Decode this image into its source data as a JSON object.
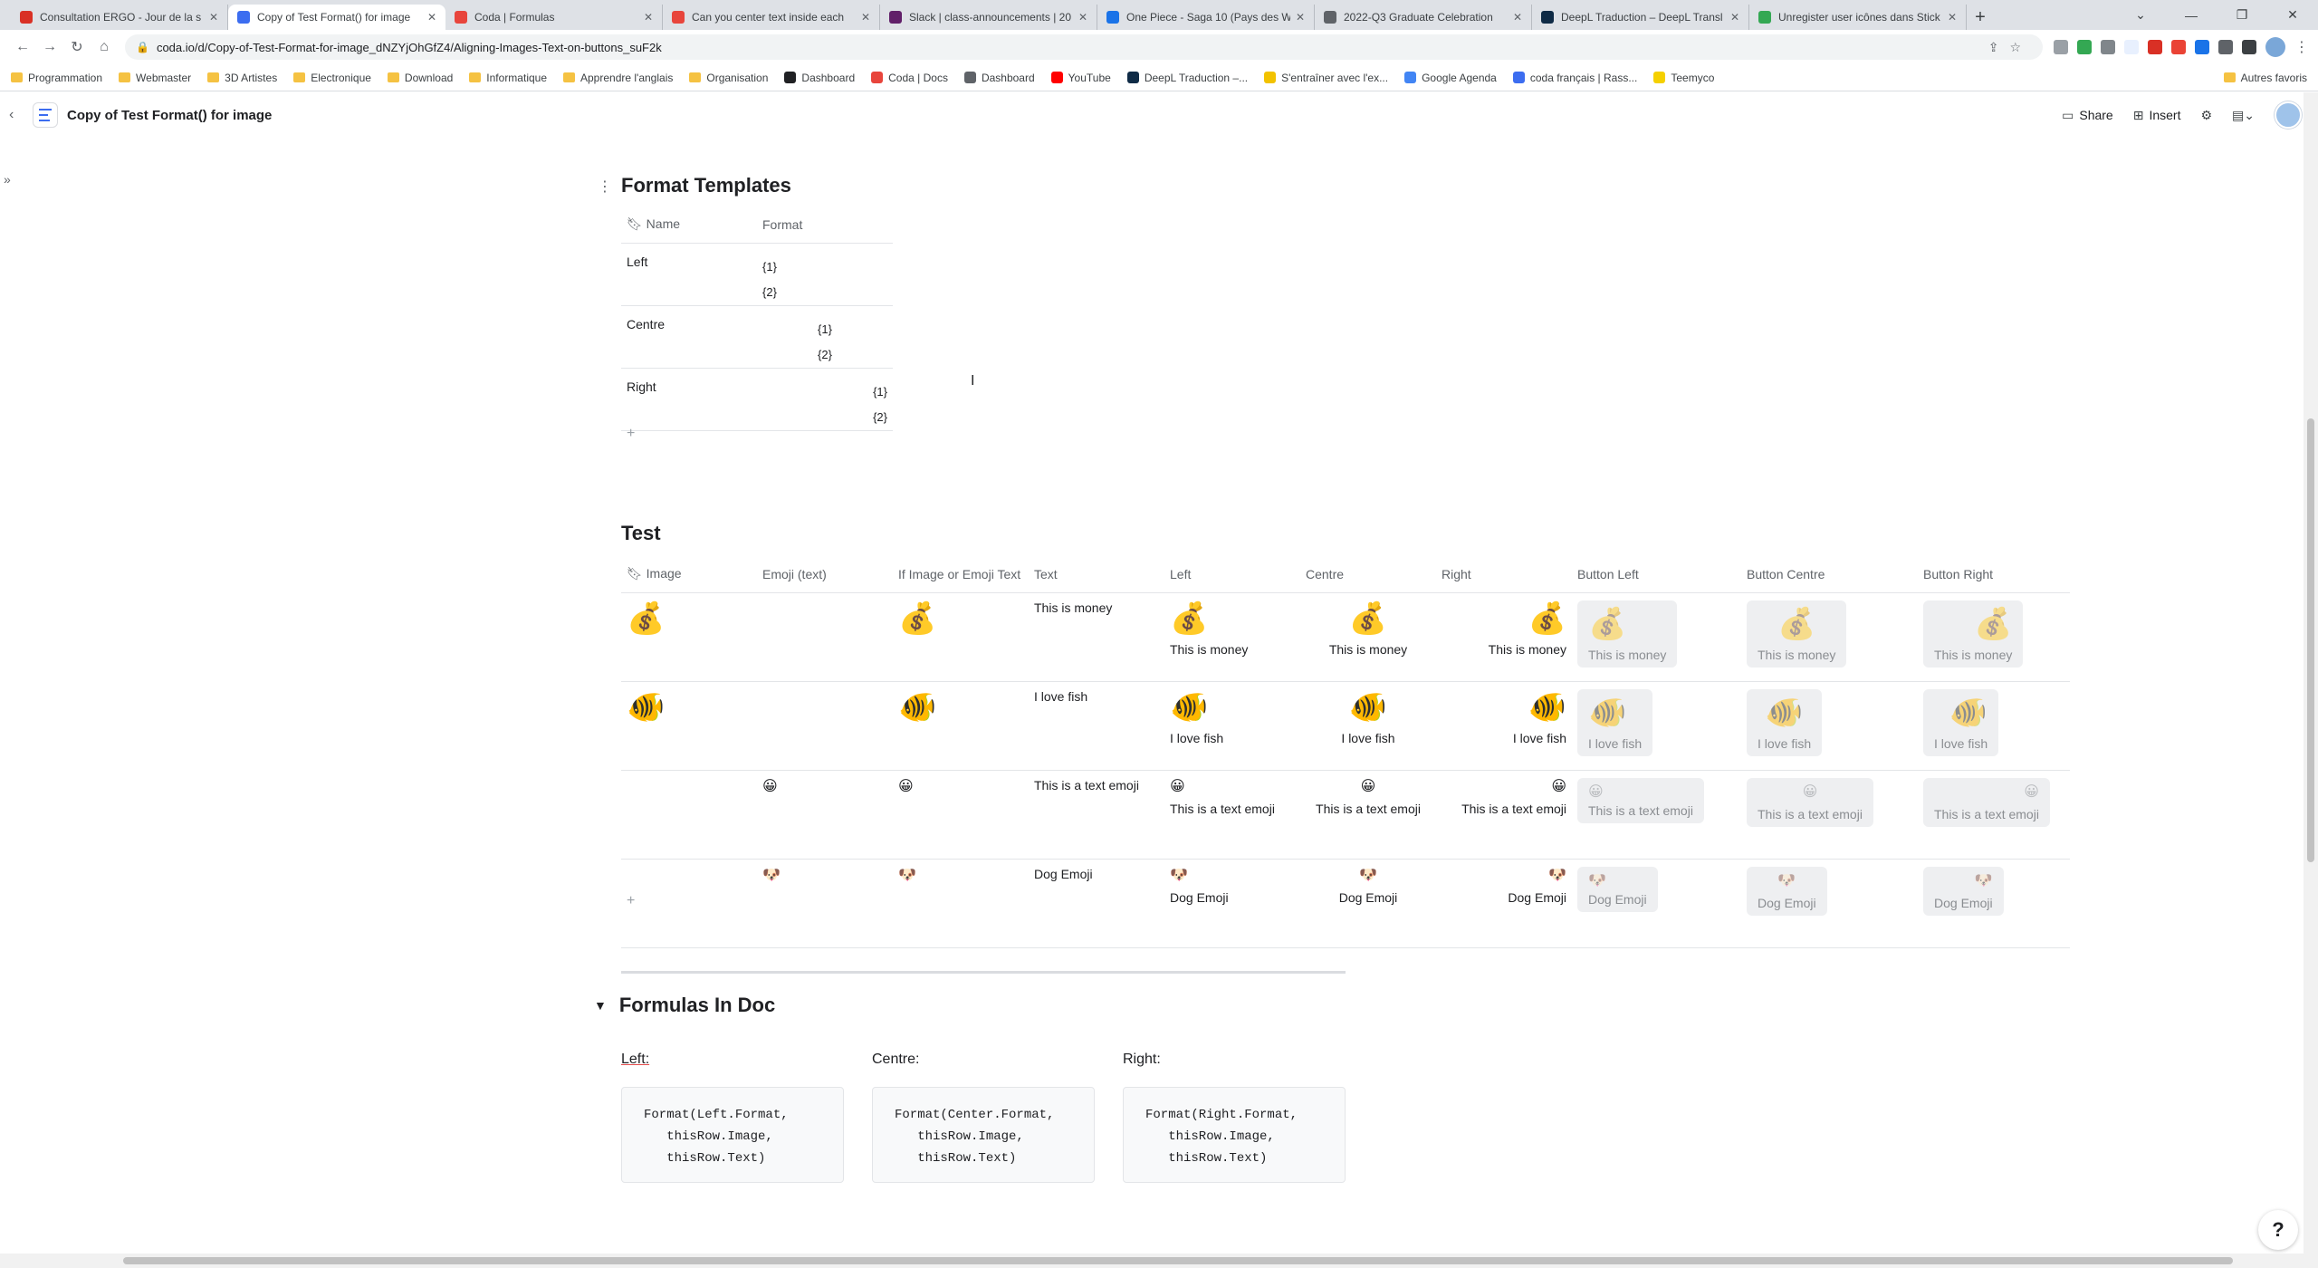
{
  "browser": {
    "tabs": [
      {
        "label": "Consultation ERGO - Jour de la s",
        "color": "#d93025"
      },
      {
        "label": "Copy of Test Format() for image",
        "color": "#3c6df0",
        "active": true
      },
      {
        "label": "Coda | Formulas",
        "color": "#e8453c"
      },
      {
        "label": "Can you center text inside each",
        "color": "#e8453c"
      },
      {
        "label": "Slack | class-announcements | 20",
        "color": "#611f69"
      },
      {
        "label": "One Piece - Saga 10 (Pays des W",
        "color": "#1a73e8"
      },
      {
        "label": "2022-Q3 Graduate Celebration",
        "color": "#5f6368"
      },
      {
        "label": "DeepL Traduction – DeepL Transl",
        "color": "#0f2b46"
      },
      {
        "label": "Unregister user icônes dans Stick",
        "color": "#34a853"
      }
    ],
    "new_tab": "+",
    "url": "coda.io/d/Copy-of-Test-Format-for-image_dNZYjOhGfZ4/Aligning-Images-Text-on-buttons_suF2k",
    "bookmarks": [
      {
        "label": "Programmation",
        "type": "folder"
      },
      {
        "label": "Webmaster",
        "type": "folder"
      },
      {
        "label": "3D Artistes",
        "type": "folder"
      },
      {
        "label": "Electronique",
        "type": "folder"
      },
      {
        "label": "Download",
        "type": "folder"
      },
      {
        "label": "Informatique",
        "type": "folder"
      },
      {
        "label": "Apprendre l'anglais",
        "type": "folder"
      },
      {
        "label": "Organisation",
        "type": "folder"
      },
      {
        "label": "Dashboard",
        "type": "site",
        "color": "#202124"
      },
      {
        "label": "Coda | Docs",
        "type": "site",
        "color": "#e8453c"
      },
      {
        "label": "Dashboard",
        "type": "site",
        "color": "#5f6368"
      },
      {
        "label": "YouTube",
        "type": "site",
        "color": "#ff0000"
      },
      {
        "label": "DeepL Traduction –...",
        "type": "site",
        "color": "#0f2b46"
      },
      {
        "label": "S'entraîner avec l'ex...",
        "type": "site",
        "color": "#f2c200"
      },
      {
        "label": "Google Agenda",
        "type": "site",
        "color": "#4285f4"
      },
      {
        "label": "coda français | Rass...",
        "type": "site",
        "color": "#3c6df0"
      },
      {
        "label": "Teemyco",
        "type": "site",
        "color": "#f5d000"
      }
    ],
    "other_bookmarks": "Autres favoris"
  },
  "doc": {
    "title": "Copy of Test Format() for image",
    "share": "Share",
    "insert": "Insert"
  },
  "format_templates": {
    "title": "Format Templates",
    "headers": [
      "Name",
      "Format"
    ],
    "rows": [
      {
        "name": "Left",
        "line1": "{1}",
        "line2": "{2}"
      },
      {
        "name": "Centre",
        "line1": "{1}",
        "line2": "{2}"
      },
      {
        "name": "Right",
        "line1": "{1}",
        "line2": "{2}"
      }
    ],
    "add": "+"
  },
  "test": {
    "title": "Test",
    "headers": [
      "Image",
      "Emoji (text)",
      "If Image or Emoji Text",
      "Text",
      "Left",
      "Centre",
      "Right",
      "Button Left",
      "Button Centre",
      "Button Right"
    ],
    "rows": [
      {
        "text": "This is money"
      },
      {
        "text": "I love fish"
      },
      {
        "text": "This is a text emoji"
      },
      {
        "text": "Dog Emoji"
      }
    ],
    "add": "+"
  },
  "formulas": {
    "title": "Formulas In Doc",
    "left_label": "Left:",
    "centre_label": "Centre:",
    "right_label": "Right:",
    "left_code": "Format(Left.Format,\n   thisRow.Image,\n   thisRow.Text)",
    "centre_code": "Format(Center.Format,\n   thisRow.Image,\n   thisRow.Text)",
    "right_code": "Format(Right.Format,\n   thisRow.Image,\n   thisRow.Text)"
  },
  "help": "?"
}
